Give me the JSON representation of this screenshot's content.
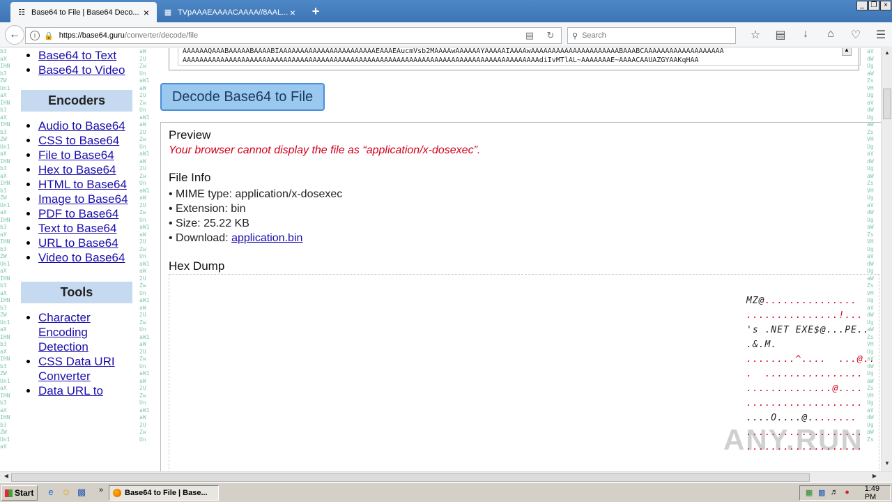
{
  "browser": {
    "tabs": [
      {
        "title": "Base64 to File | Base64 Deco...",
        "active": true
      },
      {
        "title": "TVpAAAEAAAACAAAA//8AAL...",
        "active": false
      }
    ],
    "url_host": "https://base64.guru",
    "url_path": "/converter/decode/file",
    "search_placeholder": "Search"
  },
  "sidebar": {
    "top_links": [
      "Base64 to Text",
      "Base64 to Video"
    ],
    "encoders_title": "Encoders",
    "encoders": [
      "Audio to Base64",
      "CSS to Base64",
      "File to Base64",
      "Hex to Base64",
      "HTML to Base64",
      "Image to Base64",
      "PDF to Base64",
      "Text to Base64",
      "URL to Base64",
      "Video to Base64"
    ],
    "tools_title": "Tools",
    "tools": [
      "Character Encoding Detection",
      "CSS Data URI Converter",
      "Data URL to"
    ]
  },
  "input": {
    "line1": "AAAAAAQAAABAAAAABAAAABIAAAAAAAAAAAAAAAAAAAAAAAEAAAEAucmVsb2MAAAAwAAAAAAYAAAAAIAAAAwAAAAAAAAAAAAAAAAAAAAABAAABCAAAAAAAAAAAAAAAAAAA",
    "line2": "AAAAAAAAAAAAAAAAAAAAAAAAAAAAAAAAAAAAAAAAAAAAAAAAAAAAAAAAAAAAAAAAAAAAAAAAAAAAAAAAAAAAAdiIvMTlAL~AAAAAAAE~AAAACAAUAZGYAAKqHAA"
  },
  "decode_button": "Decode Base64 to File",
  "preview": {
    "heading": "Preview",
    "error": "Your browser cannot display the file as “application/x-dosexec”."
  },
  "file_info": {
    "heading": "File Info",
    "mime_label": "• MIME type: application/x-dosexec",
    "ext_label": "• Extension: bin",
    "size_label": "• Size: 25.22 KB",
    "download_prefix": "• Download: ",
    "download_link": "application.bin"
  },
  "hex_dump": {
    "heading": "Hex Dump",
    "lines": [
      [
        "MZ@",
        "..............."
      ],
      [
        "",
        "...............!..."
      ],
      [
        "'s .NET EXE$@...PE..",
        ""
      ],
      [
        ".&.M.",
        ""
      ],
      [
        "",
        "........^....  ...@.."
      ],
      [
        "",
        ".  ................"
      ],
      [
        "",
        "..............@...."
      ],
      [
        "",
        "..................."
      ],
      [
        "....O....@.",
        "......."
      ],
      [
        "",
        "..................."
      ],
      [
        "",
        "..................."
      ]
    ]
  },
  "watermark": "ANY.RUN",
  "taskbar": {
    "start": "Start",
    "task": "Base64 to File | Base...",
    "clock": "1:49 PM"
  }
}
